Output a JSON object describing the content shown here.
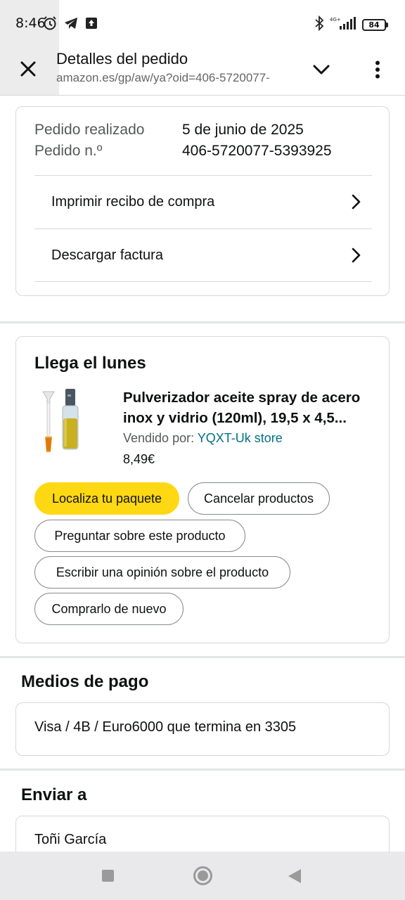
{
  "status_bar": {
    "time": "8:46",
    "network": "4G+",
    "battery": "84"
  },
  "tab": {
    "title": "Detalles del pedido",
    "url": "amazon.es/gp/aw/ya?oid=406-5720077-"
  },
  "order": {
    "placed_label": "Pedido realizado",
    "placed_value": "5 de junio de 2025",
    "number_label": "Pedido n.º",
    "number_value": "406-5720077-5393925",
    "links": [
      "Imprimir recibo de compra",
      "Descargar factura"
    ]
  },
  "delivery": {
    "title": "Llega el lunes",
    "product_title": "Pulverizador aceite spray de acero inox y vidrio (120ml), 19,5 x 4,5...",
    "seller_label": "Vendido por:",
    "seller_name": "YQXT-Uk store",
    "price": "8,49€",
    "buttons": {
      "track": "Localiza tu paquete",
      "cancel": "Cancelar productos",
      "ask": "Preguntar sobre este producto",
      "review": "Escribir una opinión sobre el producto",
      "buy_again": "Comprarlo de nuevo"
    }
  },
  "payment": {
    "title": "Medios de pago",
    "method": "Visa / 4B / Euro6000  que termina en 3305"
  },
  "shipping": {
    "title": "Enviar a",
    "name": "Toñi García"
  },
  "colors": {
    "primary_button": "#ffd814",
    "link": "#007185",
    "text": "#0f1111",
    "secondary_text": "#565959"
  }
}
